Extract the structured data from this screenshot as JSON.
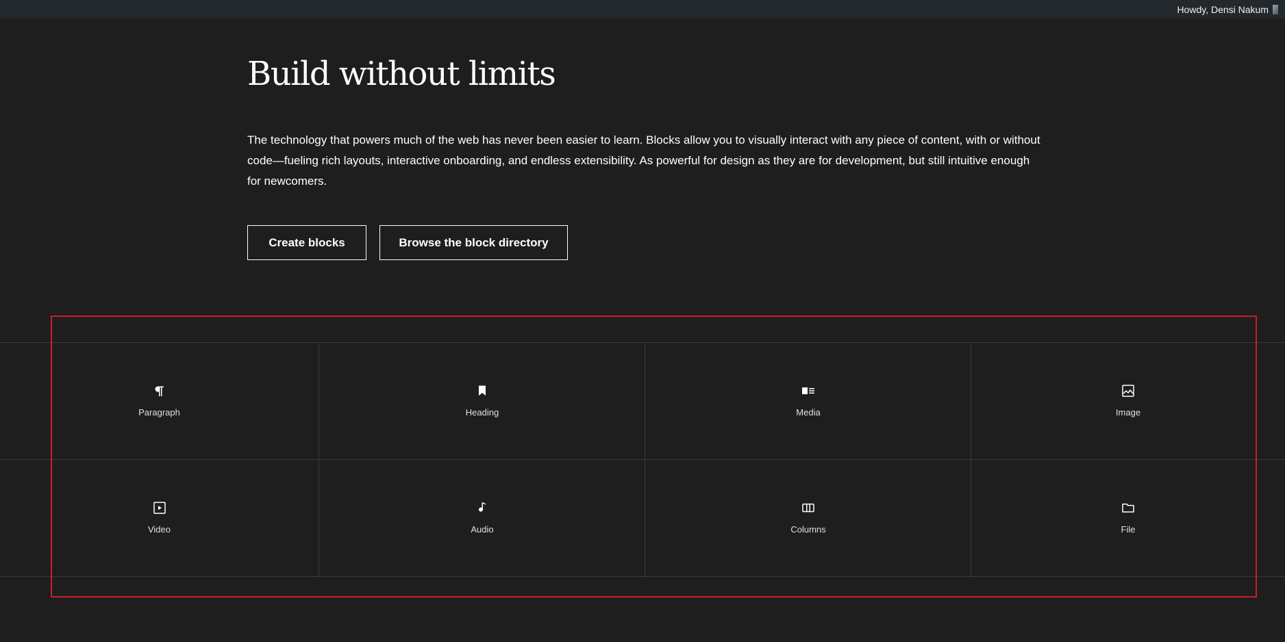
{
  "adminbar": {
    "greeting": "Howdy, Densi Nakum"
  },
  "hero": {
    "title": "Build without limits",
    "description": "The technology that powers much of the web has never been easier to learn. Blocks allow you to visually interact with any piece of content, with or without code—fueling rich layouts, interactive onboarding, and endless extensibility. As powerful for design as they are for development, but still intuitive enough for newcomers."
  },
  "buttons": {
    "create_label": "Create blocks",
    "browse_label": "Browse the block directory"
  },
  "blocks": [
    {
      "label": "Paragraph",
      "icon": "paragraph-icon"
    },
    {
      "label": "Heading",
      "icon": "heading-icon"
    },
    {
      "label": "Media",
      "icon": "media-text-icon"
    },
    {
      "label": "Image",
      "icon": "image-icon"
    },
    {
      "label": "Video",
      "icon": "video-icon"
    },
    {
      "label": "Audio",
      "icon": "audio-icon"
    },
    {
      "label": "Columns",
      "icon": "columns-icon"
    },
    {
      "label": "File",
      "icon": "file-folder-icon"
    }
  ],
  "colors": {
    "background": "#1e1e1e",
    "adminbar": "#23282d",
    "highlight": "#cc1f1f"
  }
}
